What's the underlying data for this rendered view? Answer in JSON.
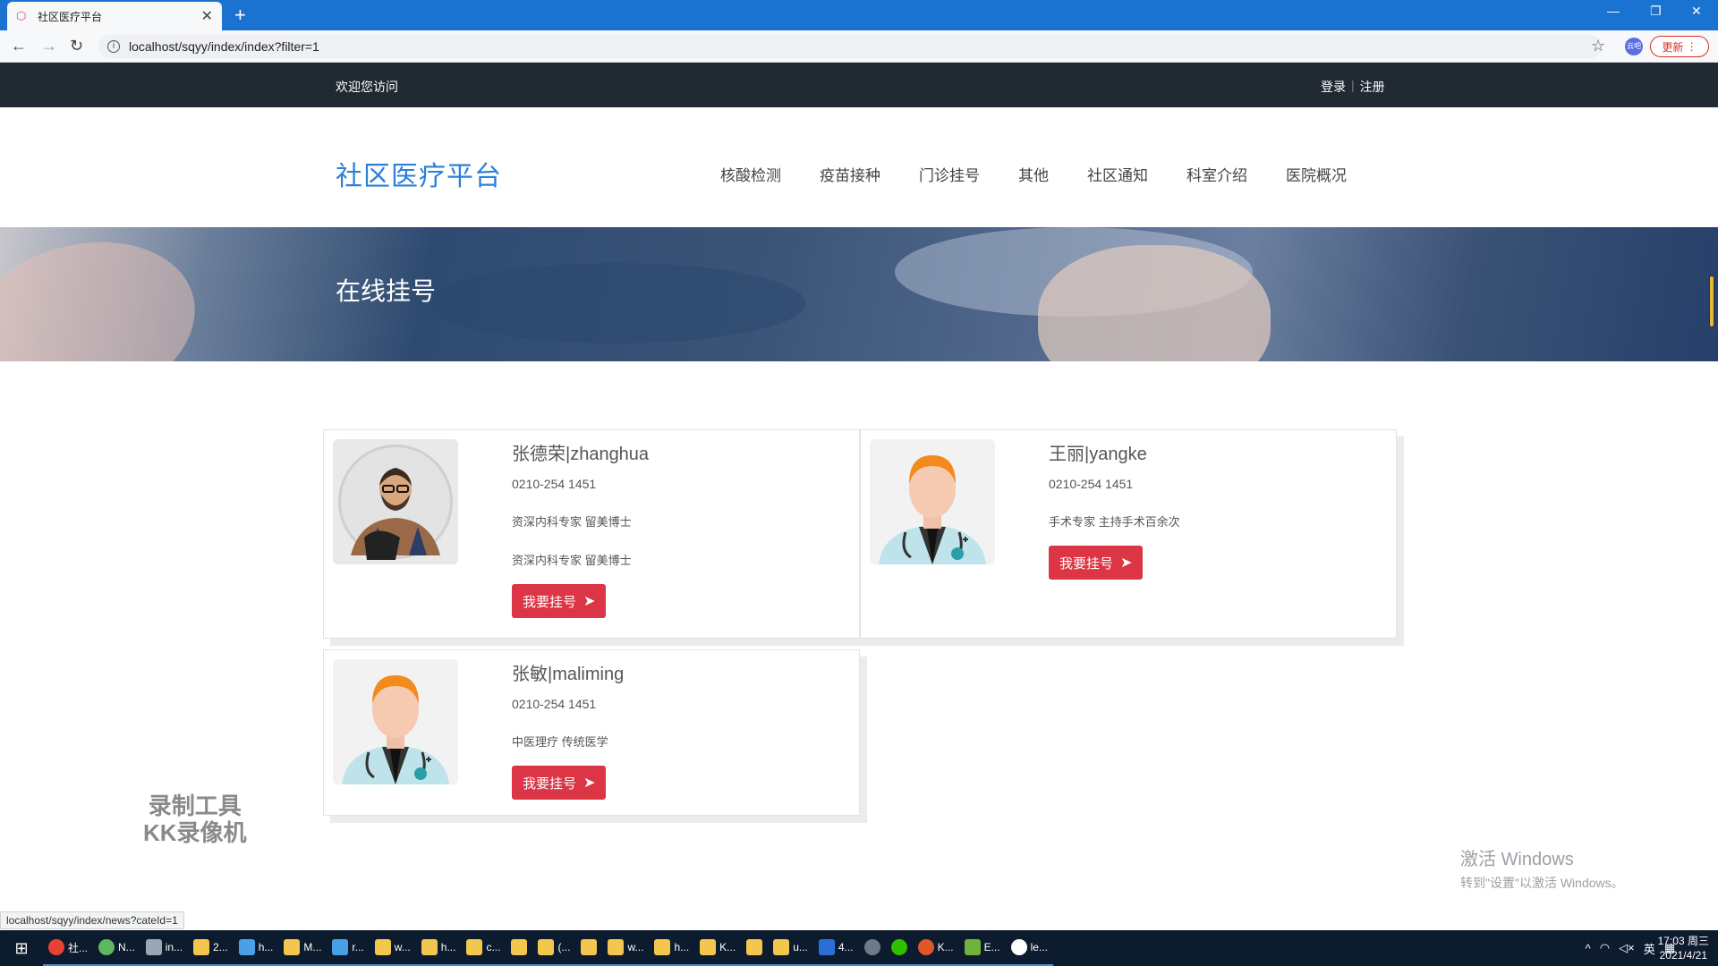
{
  "browser": {
    "tab_title": "社区医疗平台",
    "tab_close": "✕",
    "new_tab": "+",
    "url": "localhost/sqyy/index/index?filter=1",
    "ext_label": "云吧",
    "update_label": "更新",
    "status_url": "localhost/sqyy/index/news?cateId=1"
  },
  "topbar": {
    "welcome": "欢迎您访问",
    "login": "登录",
    "separator": "|",
    "register": "注册"
  },
  "site": {
    "logo": "社区医疗平台",
    "nav": [
      "核酸检测",
      "疫苗接种",
      "门诊挂号",
      "其他",
      "社区通知",
      "科室介绍",
      "医院概况"
    ]
  },
  "banner": {
    "title": "在线挂号"
  },
  "doctors": [
    {
      "name": "张德荣|zhanghua",
      "phone": "0210-254 1451",
      "desc1": "资深内科专家 留美博士",
      "desc2": "资深内科专家 留美博士",
      "button": "我要挂号",
      "avatar": "photo-man-avatar"
    },
    {
      "name": "王丽|yangke",
      "phone": "0210-254 1451",
      "desc1": "手术专家 主持手术百余次",
      "button": "我要挂号",
      "avatar": "doctor-avatar"
    },
    {
      "name": "张敏|maliming",
      "phone": "0210-254 1451",
      "desc1": "中医理疗 传统医学",
      "button": "我要挂号",
      "avatar": "doctor-avatar"
    }
  ],
  "overlays": {
    "watermark_line1": "录制工具",
    "watermark_line2": "KK录像机",
    "activate_title": "激活 Windows",
    "activate_sub": "转到\"设置\"以激活 Windows。"
  },
  "taskbar": {
    "items": [
      "社...",
      "N...",
      "in...",
      "2...",
      "h...",
      "M...",
      "r...",
      "w...",
      "h...",
      "c...",
      "",
      "(...",
      "",
      "w...",
      "h...",
      "K...",
      "",
      "u...",
      "4...",
      "",
      "",
      "K...",
      "E...",
      "le..."
    ],
    "ime": "英",
    "time": "17:03 周三",
    "date": "2021/4/21"
  },
  "colors": {
    "accent": "#2b7fd9",
    "button": "#dc3545",
    "topbar": "#212a33",
    "taskbar": "#0d1b2e"
  }
}
